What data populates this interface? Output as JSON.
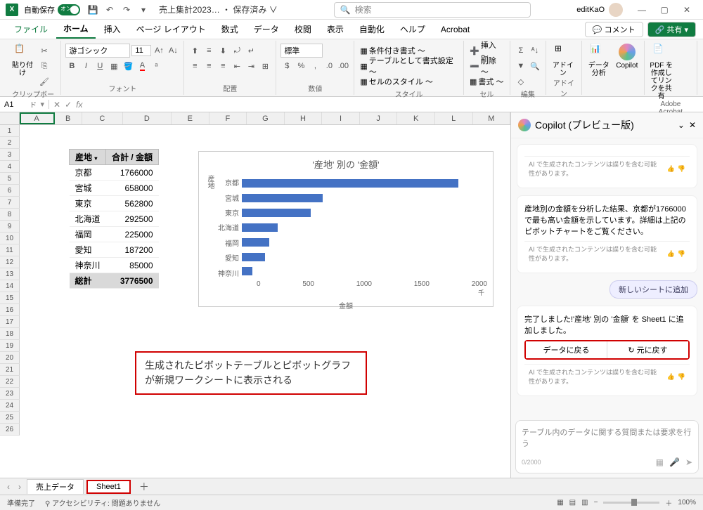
{
  "titlebar": {
    "autosave_label": "自動保存",
    "autosave_on": "オン",
    "doc_title": "売上集計2023… ・ 保存済み ∨",
    "search_placeholder": "検索",
    "username": "editKaO"
  },
  "menu": {
    "file": "ファイル",
    "home": "ホーム",
    "insert": "挿入",
    "page_layout": "ページ レイアウト",
    "formulas": "数式",
    "data": "データ",
    "review": "校閲",
    "view": "表示",
    "automate": "自動化",
    "help": "ヘルプ",
    "acrobat": "Acrobat",
    "comment": "コメント",
    "share": "共有"
  },
  "ribbon": {
    "font_name": "游ゴシック",
    "font_size": "11",
    "number_format": "標準",
    "groups": {
      "clipboard": "クリップボード",
      "font": "フォント",
      "alignment": "配置",
      "number": "数値",
      "styles": "スタイル",
      "cells": "セル",
      "editing": "編集",
      "addins": "アドイン",
      "acrobat": "Adobe Acrobat"
    },
    "paste": "貼り付け",
    "cond_fmt": "条件付き書式 ～",
    "table_fmt": "テーブルとして書式設定 ～",
    "cell_style": "セルのスタイル ～",
    "insert_cell": "挿入 ～",
    "delete_cell": "削除 ～",
    "format_cell": "書式 ～",
    "addin": "アドイン",
    "analyze": "データ分析",
    "copilot": "Copilot",
    "pdf": "PDF を作成してリンクを共有"
  },
  "name_box": "A1",
  "pivot": {
    "headers": [
      "産地",
      "合計 / 金額"
    ],
    "rows": [
      {
        "label": "京都",
        "value": "1766000"
      },
      {
        "label": "宮城",
        "value": "658000"
      },
      {
        "label": "東京",
        "value": "562800"
      },
      {
        "label": "北海道",
        "value": "292500"
      },
      {
        "label": "福岡",
        "value": "225000"
      },
      {
        "label": "愛知",
        "value": "187200"
      },
      {
        "label": "神奈川",
        "value": "85000"
      }
    ],
    "total_label": "総計",
    "total_value": "3776500"
  },
  "chart_data": {
    "type": "bar",
    "title": "'産地' 別の '金額'",
    "ylabel": "産地",
    "xlabel": "金額",
    "xunit": "千",
    "xticks": [
      "0",
      "500",
      "1000",
      "1500",
      "2000"
    ],
    "categories": [
      "京都",
      "宮城",
      "東京",
      "北海道",
      "福岡",
      "愛知",
      "神奈川"
    ],
    "values": [
      1766,
      658,
      562.8,
      292.5,
      225,
      187.2,
      85
    ],
    "xmax": 2000
  },
  "annotation": "生成されたピボットテーブルとピボットグラフが新規ワークシートに表示される",
  "sheet_tabs": {
    "tab1": "売上データ",
    "tab2": "Sheet1"
  },
  "copilot": {
    "title": "Copilot (プレビュー版)",
    "disclaimer": "AI で生成されたコンテンツは誤りを含む可能性があります。",
    "analysis": "産地別の金額を分析した結果、京都が1766000で最も高い金額を示しています。詳細は上記のピボットチャートをご覧ください。",
    "add_sheet_btn": "新しいシートに追加",
    "done": "完了しました!'産地' 別の '金額' を Sheet1 に追加しました。",
    "back_data": "データに戻る",
    "undo": "↻ 元に戻す",
    "input_placeholder": "テーブル内のデータに関する質問または要求を行う",
    "char_count": "0/2000"
  },
  "status": {
    "ready": "準備完了",
    "accessibility": "アクセシビリティ: 問題ありません",
    "zoom": "100%"
  }
}
